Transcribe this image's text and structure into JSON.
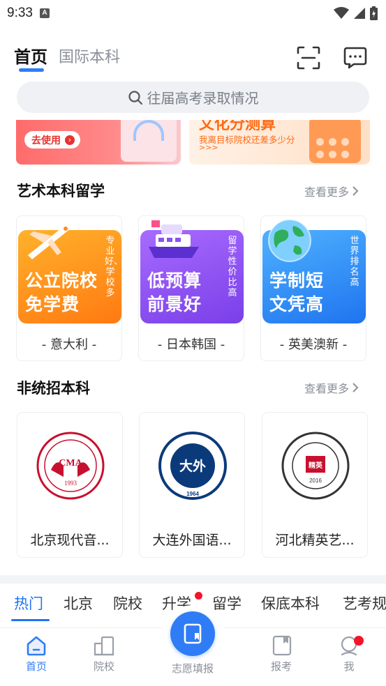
{
  "status_bar": {
    "time": "9:33",
    "notif_letter": "A"
  },
  "header": {
    "tabs": [
      {
        "label": "首页",
        "active": true
      },
      {
        "label": "国际本科",
        "active": false
      }
    ],
    "icons": [
      "scan-icon",
      "message-icon"
    ]
  },
  "search": {
    "placeholder": "往届高考录取情况"
  },
  "banners": {
    "left": {
      "button_label": "去使用"
    },
    "right": {
      "title": "文化分测算",
      "line1": "我离目标院校还差多少分",
      "line2": ">>>"
    }
  },
  "art_section": {
    "title": "艺术本科留学",
    "more": "查看更多",
    "cards": [
      {
        "headline1": "公立院校",
        "headline2": "免学费",
        "side": "专业好、学校多",
        "label": "- 意大利 -",
        "color": "#ff8a1f"
      },
      {
        "headline1": "低预算",
        "headline2": "前景好",
        "side": "留学性价比高",
        "label": "- 日本韩国 -",
        "color": "#8b52f0"
      },
      {
        "headline1": "学制短",
        "headline2": "文凭高",
        "side": "世界排名高",
        "label": "- 英美澳新 -",
        "color": "#2d8df4"
      }
    ]
  },
  "nonunified_section": {
    "title": "非统招本科",
    "more": "查看更多",
    "schools": [
      {
        "name": "北京现代音...",
        "logo_text": "CMA",
        "logo_year": "1993",
        "color": "#c8102e"
      },
      {
        "name": "大连外国语...",
        "logo_text": "大外",
        "logo_year": "1964",
        "color": "#0b3a7a"
      },
      {
        "name": "河北精英艺...",
        "logo_text": "精英",
        "logo_year": "2016",
        "color": "#333333"
      }
    ]
  },
  "category_tabs": [
    {
      "label": "热门",
      "active": true
    },
    {
      "label": "北京",
      "active": false
    },
    {
      "label": "院校",
      "active": false
    },
    {
      "label": "升学",
      "active": false,
      "badge": true
    },
    {
      "label": "留学",
      "active": false
    },
    {
      "label": "保底本科",
      "active": false
    },
    {
      "label": "艺考规",
      "active": false
    }
  ],
  "bottom_nav": [
    {
      "label": "首页",
      "icon": "home-icon",
      "active": true
    },
    {
      "label": "院校",
      "icon": "school-icon",
      "active": false
    },
    {
      "label": "志愿填报",
      "icon": "form-icon",
      "active": false,
      "center": true
    },
    {
      "label": "报考",
      "icon": "apply-icon",
      "active": false
    },
    {
      "label": "我",
      "icon": "profile-icon",
      "active": false,
      "badge": true
    }
  ],
  "colors": {
    "accent": "#2f7cf6",
    "tab_blue": "#1d74f5",
    "badge_red": "#f2152a"
  }
}
